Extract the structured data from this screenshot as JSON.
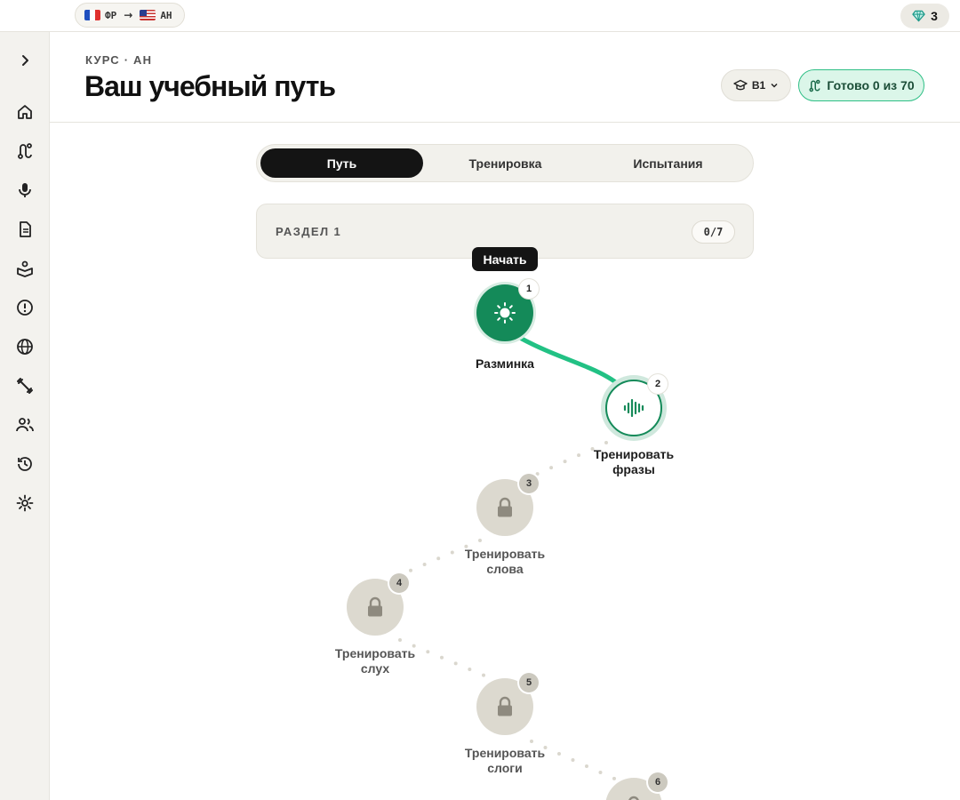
{
  "topbar": {
    "from_lang": "ФР",
    "to_lang": "АН",
    "gems": "3",
    "from_flag": "flag-fr-icon",
    "to_flag": "flag-us-icon"
  },
  "header": {
    "kicker": "КУРС · АН",
    "title": "Ваш учебный путь",
    "level": "B1",
    "progress": "Готово 0 из 70"
  },
  "tabs": [
    {
      "label": "Путь",
      "active": true
    },
    {
      "label": "Тренировка",
      "active": false
    },
    {
      "label": "Испытания",
      "active": false
    }
  ],
  "section": {
    "label": "РАЗДЕЛ 1",
    "count": "0/7"
  },
  "tooltip": "Начать",
  "nodes": [
    {
      "num": "1",
      "label": "Разминка",
      "state": "done",
      "icon": "sun-icon"
    },
    {
      "num": "2",
      "label_line1": "Тренировать",
      "label_line2": "фразы",
      "state": "current",
      "icon": "waveform-icon"
    },
    {
      "num": "3",
      "label_line1": "Тренировать",
      "label_line2": "слова",
      "state": "locked",
      "icon": "lock-icon"
    },
    {
      "num": "4",
      "label_line1": "Тренировать",
      "label_line2": "слух",
      "state": "locked",
      "icon": "lock-icon"
    },
    {
      "num": "5",
      "label_line1": "Тренировать",
      "label_line2": "слоги",
      "state": "locked",
      "icon": "lock-icon"
    },
    {
      "num": "6",
      "state": "locked",
      "icon": "lock-icon"
    }
  ],
  "colors": {
    "accent": "#148a59",
    "accent_light": "#2fbf86",
    "locked": "#dcd9cf",
    "sidebar_bg": "#f3f2ee"
  }
}
